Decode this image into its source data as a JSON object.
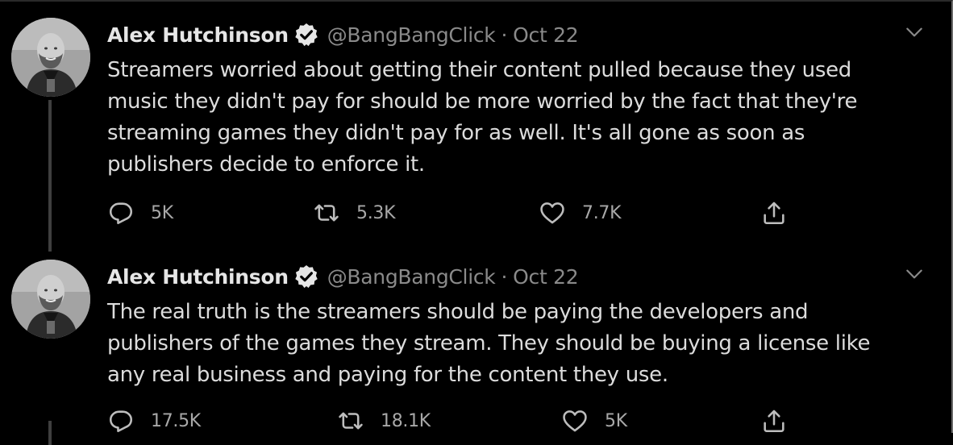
{
  "tweets": [
    {
      "author": {
        "name": "Alex Hutchinson",
        "handle": "@BangBangClick",
        "verified": true
      },
      "separator": "·",
      "date": "Oct 22",
      "text_lines": [
        "Streamers worried about getting their content pulled because they used",
        "music they didn't pay for should be more worried by the fact that they're",
        "streaming games they didn't pay for as well. It's all gone as soon as",
        "publishers decide to enforce it."
      ],
      "replies": "5K",
      "retweets": "5.3K",
      "likes": "7.7K"
    },
    {
      "author": {
        "name": "Alex Hutchinson",
        "handle": "@BangBangClick",
        "verified": true
      },
      "separator": "·",
      "date": "Oct 22",
      "text_lines": [
        "The real truth is the streamers should be paying the developers and",
        "publishers of the games they stream. They should be buying a license like",
        "any real business and paying for the content they use."
      ],
      "replies": "17.5K",
      "retweets": "18.1K",
      "likes": "5K"
    }
  ],
  "icons": {
    "reply": "reply-icon",
    "retweet": "retweet-icon",
    "like": "heart-icon",
    "share": "share-icon",
    "more": "chevron-down-icon",
    "verified": "verified-badge-icon"
  },
  "colors": {
    "background": "#000000",
    "text": "#dcdcdc",
    "muted": "#8a8a8a",
    "icon": "#bdbdbd"
  }
}
